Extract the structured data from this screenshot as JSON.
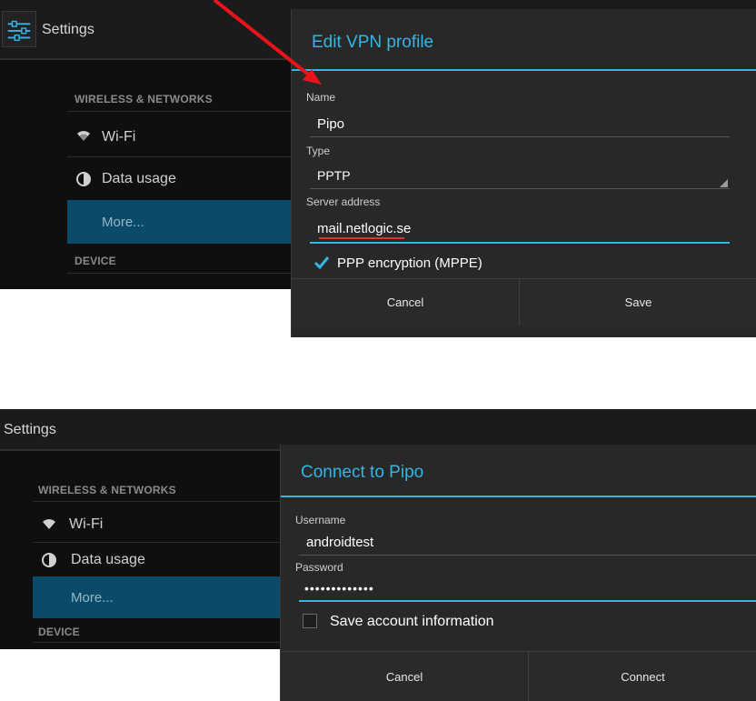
{
  "shot1": {
    "app_title": "Settings",
    "section_wireless": "WIRELESS & NETWORKS",
    "wifi": "Wi-Fi",
    "data_usage": "Data usage",
    "more": "More...",
    "section_device": "DEVICE",
    "dialog": {
      "title": "Edit VPN profile",
      "name_label": "Name",
      "name_value": "Pipo",
      "type_label": "Type",
      "type_value": "PPTP",
      "server_label": "Server address",
      "server_value": "mail.netlogic.se",
      "encryption_label": "PPP encryption (MPPE)",
      "encryption_checked": true,
      "cancel": "Cancel",
      "save": "Save"
    }
  },
  "shot2": {
    "app_title": "Settings",
    "section_wireless": "WIRELESS & NETWORKS",
    "wifi": "Wi-Fi",
    "data_usage": "Data usage",
    "more": "More...",
    "section_device": "DEVICE",
    "dialog": {
      "title": "Connect to Pipo",
      "username_label": "Username",
      "username_value": "androidtest",
      "password_label": "Password",
      "password_value": "•••••••••••••",
      "save_account_label": "Save account information",
      "save_account_checked": false,
      "cancel": "Cancel",
      "connect": "Connect"
    }
  },
  "colors": {
    "accent": "#33b5e5",
    "selected_row": "#0a4b69",
    "annotation_arrow": "#e8131b",
    "spellcheck": "#e0332d"
  }
}
